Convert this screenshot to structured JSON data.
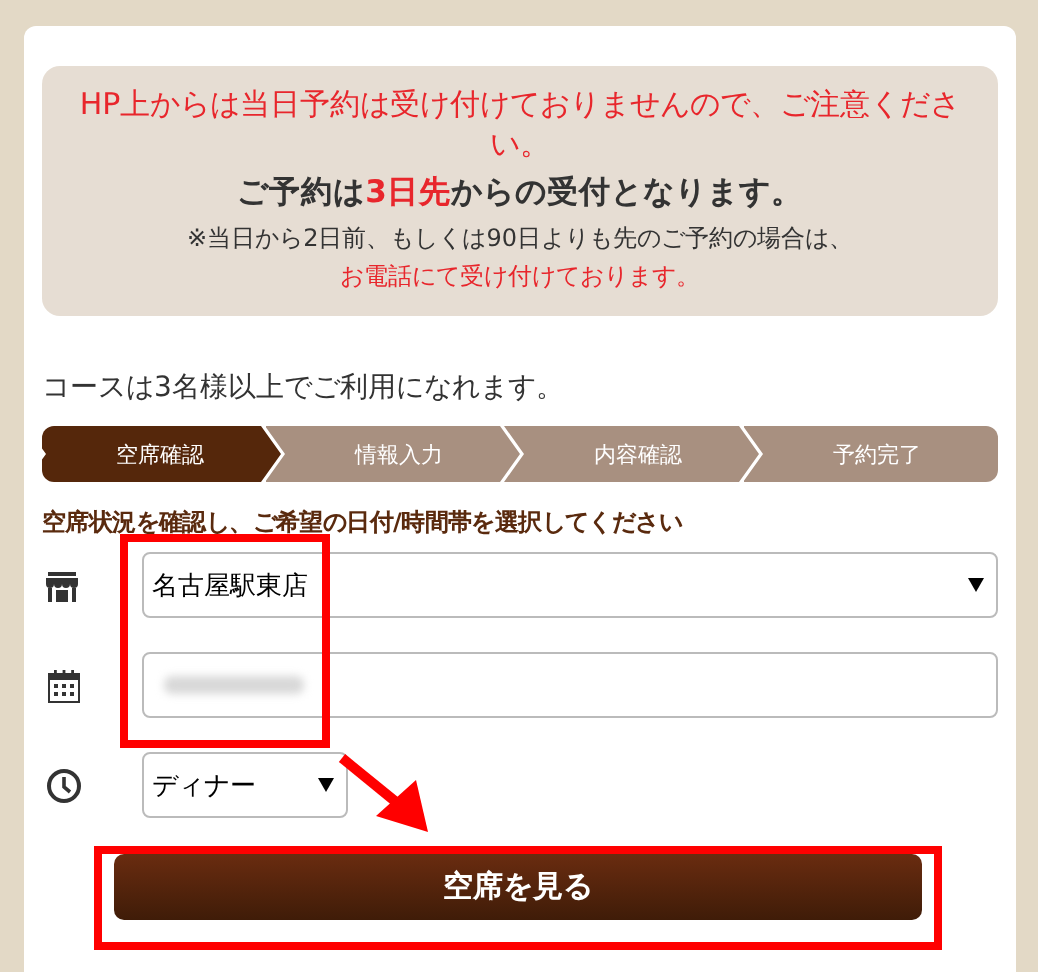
{
  "notice": {
    "warning": "HP上からは当日予約は受け付けておりませんので、ご注意ください。",
    "lead": [
      {
        "text": "ご予約は",
        "highlight": false
      },
      {
        "text": "3日先",
        "highlight": true
      },
      {
        "text": "からの受付となります。",
        "highlight": false
      }
    ],
    "note": "※当日から2日前、もしくは90日よりも先のご予約の場合は、",
    "phone_note": "お電話にて受け付けております。"
  },
  "course_note": "コースは3名様以上でご利用になれます。",
  "steps": [
    {
      "label": "空席確認",
      "selected": true
    },
    {
      "label": "情報入力",
      "selected": false
    },
    {
      "label": "内容確認",
      "selected": false
    },
    {
      "label": "予約完了",
      "selected": false
    }
  ],
  "instruction": "空席状況を確認し、ご希望の日付/時間帯を選択してください",
  "fields": [
    {
      "kind": "select",
      "value": "名古屋駅東店"
    },
    {
      "kind": "blurred"
    },
    {
      "kind": "select",
      "value": "ディナー"
    }
  ],
  "submit": "空席を見る",
  "annotations": [
    {
      "kind": "box"
    },
    {
      "kind": "box"
    },
    {
      "kind": "arrow"
    }
  ]
}
